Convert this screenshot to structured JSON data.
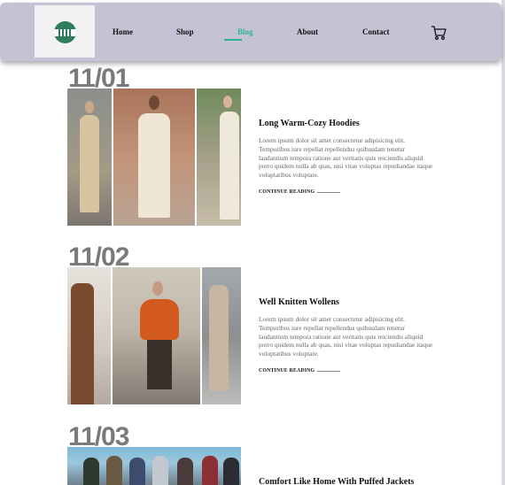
{
  "header": {
    "nav": [
      {
        "label": "Home"
      },
      {
        "label": "Shop"
      },
      {
        "label": "Blog"
      },
      {
        "label": "About"
      },
      {
        "label": "Contact"
      }
    ],
    "active": "Blog",
    "cart_icon": "cart-icon",
    "accent_color": "#2bb58a",
    "header_color": "#c4c2d4"
  },
  "posts": [
    {
      "date": "11/01",
      "title": "Long Warm-Cozy Hoodies",
      "body": "Lorem ipsum dolor sit amet consectetur adipisicing elit. Temporibus iure repellat repellendus quibusdam tenetur laudantium tempora ratione aut veritatis quis reiciendis aliquid porro quidem nulla ab quas, nisi vitae voluptas repudiandae itaque voluptatibus voluptate.",
      "read_more": "CONTINUE READING"
    },
    {
      "date": "11/02",
      "title": "Well Knitten Wollens",
      "body": "Lorem ipsum dolor sit amet consectetur adipisicing elit. Temporibus iure repellat repellendus quibusdam tenetur laudantium tempora ratione aut veritatis quis reiciendis aliquid porro quidem nulla ab quas, nisi vitae voluptas repudiandae itaque voluptatibus voluptate.",
      "read_more": "CONTINUE READING"
    },
    {
      "date": "11/03",
      "title": "Comfort Like Home With Puffed Jackets"
    }
  ]
}
